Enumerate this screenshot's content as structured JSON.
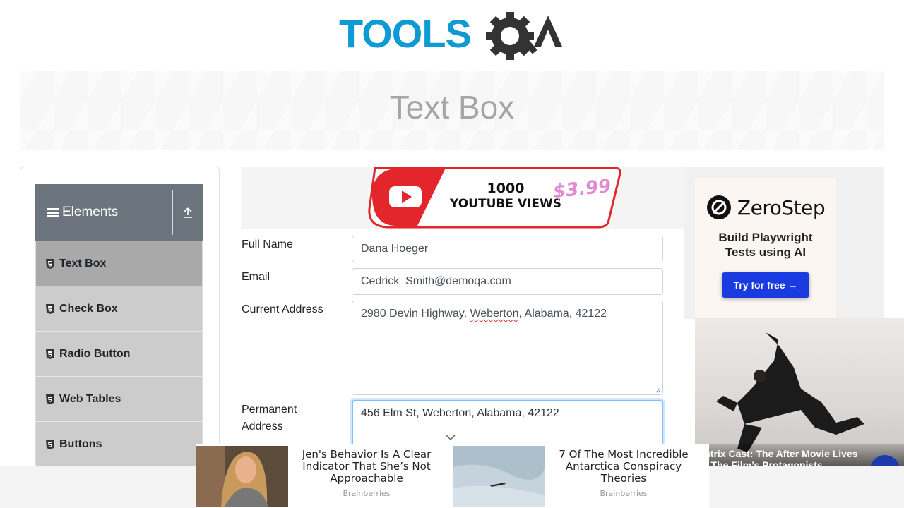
{
  "header": {
    "logo_text_left": "TOOLS",
    "logo_text_right": "A",
    "logo_color": "#0f9ad6",
    "logo_gear_color": "#333333"
  },
  "banner": {
    "title": "Text Box"
  },
  "sidebar": {
    "group_title": "Elements",
    "items": [
      {
        "label": "Text Box",
        "active": true
      },
      {
        "label": "Check Box",
        "active": false
      },
      {
        "label": "Radio Button",
        "active": false
      },
      {
        "label": "Web Tables",
        "active": false
      },
      {
        "label": "Buttons",
        "active": false
      }
    ]
  },
  "top_ad": {
    "line1": "1000",
    "line2": "YOUTUBE VIEWS",
    "price": "$3.99"
  },
  "form": {
    "full_name_label": "Full Name",
    "full_name_value": "Dana Hoeger",
    "email_label": "Email",
    "email_value": "Cedrick_Smith@demoqa.com",
    "current_address_label": "Current Address",
    "current_address_value_pre": "2980 Devin Highway, ",
    "current_address_value_mark": "Weberton",
    "current_address_value_post": ", Alabama, 42122",
    "permanent_address_label_1": "Permanent",
    "permanent_address_label_2": "Address",
    "permanent_address_value": "456 Elm St, Weberton, Alabama, 42122"
  },
  "right_ad": {
    "brand": "ZeroStep",
    "tagline_1": "Build Playwright",
    "tagline_2": "Tests using AI",
    "cta": "Try for free →"
  },
  "video_ad": {
    "caption_1": "atrix Cast: The After Movie Lives",
    "caption_2": "f The Film’s Protagonists"
  },
  "bottom_ads": [
    {
      "headline": "Jen's Behavior Is A Clear Indicator That She’s Not Approachable",
      "source": "Brainberries"
    },
    {
      "headline": "7 Of The Most Incredible Antarctica Conspiracy Theories",
      "source": "Brainberries"
    }
  ]
}
